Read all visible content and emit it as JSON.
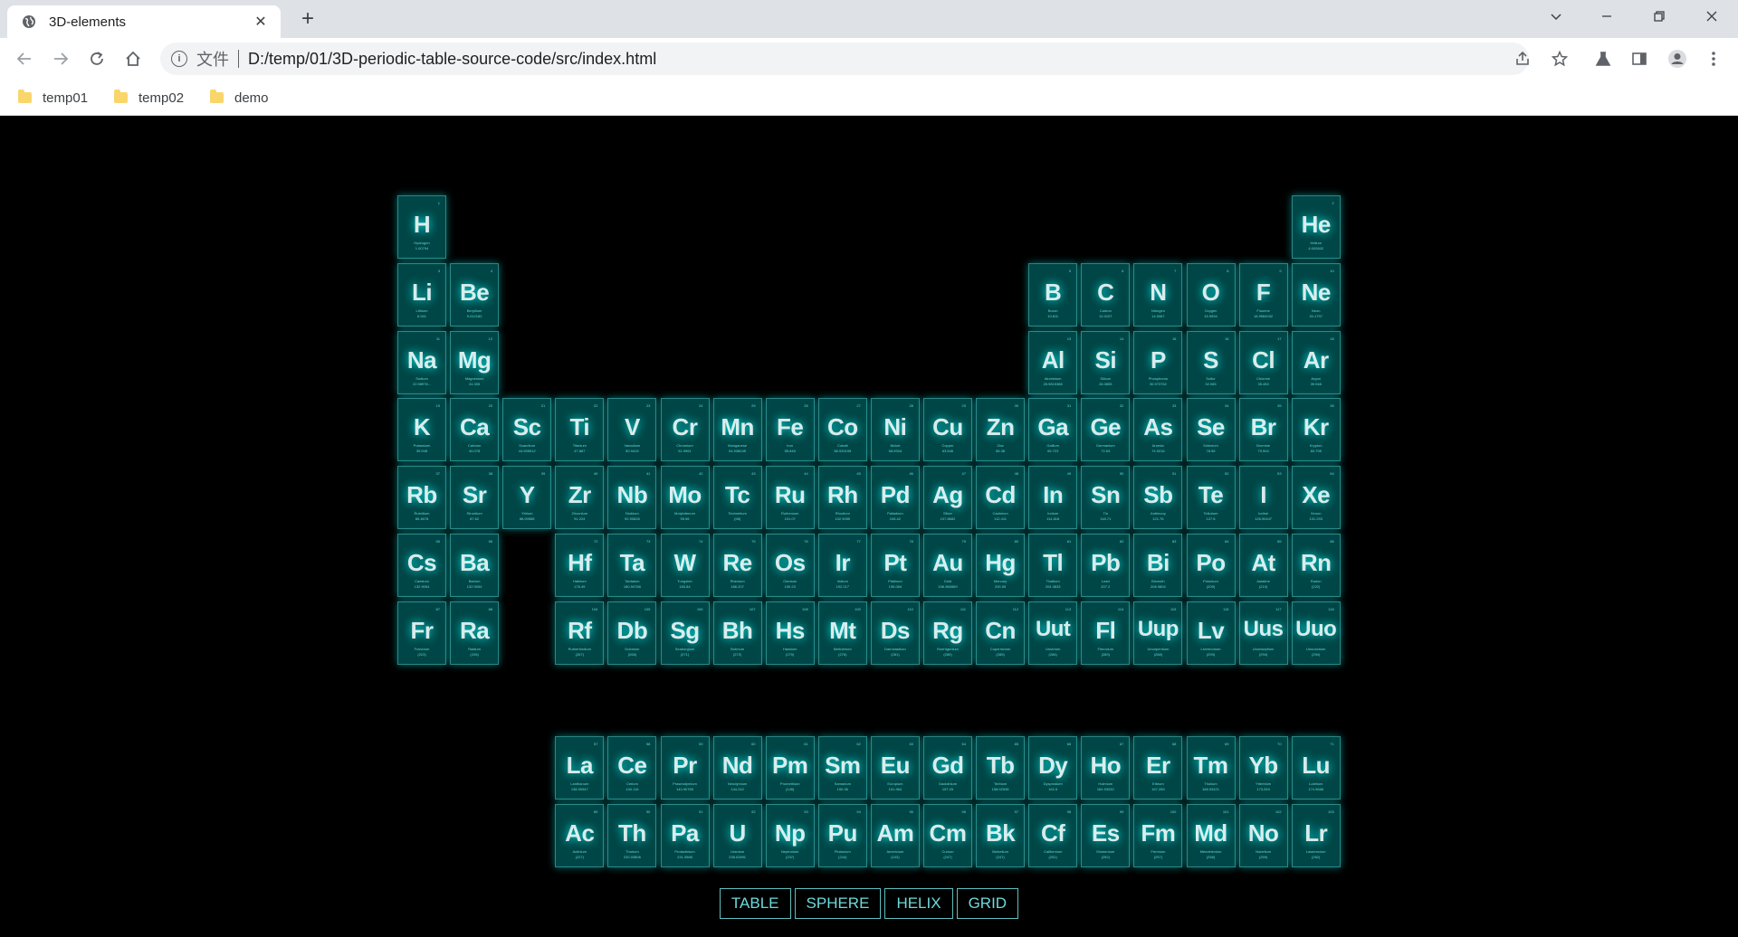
{
  "browser": {
    "tab_title": "3D-elements",
    "scheme_label": "文件",
    "url": "D:/temp/01/3D-periodic-table-source-code/src/index.html",
    "bookmarks": [
      {
        "label": "temp01"
      },
      {
        "label": "temp02"
      },
      {
        "label": "demo"
      }
    ]
  },
  "colors": {
    "background": "#000000",
    "tile": "#007f7f",
    "glow": "#00ffff",
    "bookmark_folder": "#f9d66b"
  },
  "menu": [
    {
      "label": "TABLE"
    },
    {
      "label": "SPHERE"
    },
    {
      "label": "HELIX"
    },
    {
      "label": "GRID"
    }
  ],
  "elements": [
    {
      "num": 1,
      "sym": "H",
      "name": "Hydrogen",
      "weight": "1.00794",
      "col": 1,
      "row": 1
    },
    {
      "num": 2,
      "sym": "He",
      "name": "Helium",
      "weight": "4.002602",
      "col": 18,
      "row": 1
    },
    {
      "num": 3,
      "sym": "Li",
      "name": "Lithium",
      "weight": "6.941",
      "col": 1,
      "row": 2
    },
    {
      "num": 4,
      "sym": "Be",
      "name": "Beryllium",
      "weight": "9.012182",
      "col": 2,
      "row": 2
    },
    {
      "num": 5,
      "sym": "B",
      "name": "Boron",
      "weight": "10.811",
      "col": 13,
      "row": 2
    },
    {
      "num": 6,
      "sym": "C",
      "name": "Carbon",
      "weight": "12.0107",
      "col": 14,
      "row": 2
    },
    {
      "num": 7,
      "sym": "N",
      "name": "Nitrogen",
      "weight": "14.0067",
      "col": 15,
      "row": 2
    },
    {
      "num": 8,
      "sym": "O",
      "name": "Oxygen",
      "weight": "15.9994",
      "col": 16,
      "row": 2
    },
    {
      "num": 9,
      "sym": "F",
      "name": "Fluorine",
      "weight": "18.9984032",
      "col": 17,
      "row": 2
    },
    {
      "num": 10,
      "sym": "Ne",
      "name": "Neon",
      "weight": "20.1797",
      "col": 18,
      "row": 2
    },
    {
      "num": 11,
      "sym": "Na",
      "name": "Sodium",
      "weight": "22.98976...",
      "col": 1,
      "row": 3
    },
    {
      "num": 12,
      "sym": "Mg",
      "name": "Magnesium",
      "weight": "24.305",
      "col": 2,
      "row": 3
    },
    {
      "num": 13,
      "sym": "Al",
      "name": "Aluminium",
      "weight": "26.9815386",
      "col": 13,
      "row": 3
    },
    {
      "num": 14,
      "sym": "Si",
      "name": "Silicon",
      "weight": "28.0855",
      "col": 14,
      "row": 3
    },
    {
      "num": 15,
      "sym": "P",
      "name": "Phosphorus",
      "weight": "30.973762",
      "col": 15,
      "row": 3
    },
    {
      "num": 16,
      "sym": "S",
      "name": "Sulfur",
      "weight": "32.065",
      "col": 16,
      "row": 3
    },
    {
      "num": 17,
      "sym": "Cl",
      "name": "Chlorine",
      "weight": "35.453",
      "col": 17,
      "row": 3
    },
    {
      "num": 18,
      "sym": "Ar",
      "name": "Argon",
      "weight": "39.948",
      "col": 18,
      "row": 3
    },
    {
      "num": 19,
      "sym": "K",
      "name": "Potassium",
      "weight": "39.948",
      "col": 1,
      "row": 4
    },
    {
      "num": 20,
      "sym": "Ca",
      "name": "Calcium",
      "weight": "40.078",
      "col": 2,
      "row": 4
    },
    {
      "num": 21,
      "sym": "Sc",
      "name": "Scandium",
      "weight": "44.955912",
      "col": 3,
      "row": 4
    },
    {
      "num": 22,
      "sym": "Ti",
      "name": "Titanium",
      "weight": "47.867",
      "col": 4,
      "row": 4
    },
    {
      "num": 23,
      "sym": "V",
      "name": "Vanadium",
      "weight": "50.9415",
      "col": 5,
      "row": 4
    },
    {
      "num": 24,
      "sym": "Cr",
      "name": "Chromium",
      "weight": "51.9961",
      "col": 6,
      "row": 4
    },
    {
      "num": 25,
      "sym": "Mn",
      "name": "Manganese",
      "weight": "54.938045",
      "col": 7,
      "row": 4
    },
    {
      "num": 26,
      "sym": "Fe",
      "name": "Iron",
      "weight": "55.845",
      "col": 8,
      "row": 4
    },
    {
      "num": 27,
      "sym": "Co",
      "name": "Cobalt",
      "weight": "58.933195",
      "col": 9,
      "row": 4
    },
    {
      "num": 28,
      "sym": "Ni",
      "name": "Nickel",
      "weight": "58.6934",
      "col": 10,
      "row": 4
    },
    {
      "num": 29,
      "sym": "Cu",
      "name": "Copper",
      "weight": "63.546",
      "col": 11,
      "row": 4
    },
    {
      "num": 30,
      "sym": "Zn",
      "name": "Zinc",
      "weight": "65.38",
      "col": 12,
      "row": 4
    },
    {
      "num": 31,
      "sym": "Ga",
      "name": "Gallium",
      "weight": "69.723",
      "col": 13,
      "row": 4
    },
    {
      "num": 32,
      "sym": "Ge",
      "name": "Germanium",
      "weight": "72.63",
      "col": 14,
      "row": 4
    },
    {
      "num": 33,
      "sym": "As",
      "name": "Arsenic",
      "weight": "74.9216",
      "col": 15,
      "row": 4
    },
    {
      "num": 34,
      "sym": "Se",
      "name": "Selenium",
      "weight": "78.96",
      "col": 16,
      "row": 4
    },
    {
      "num": 35,
      "sym": "Br",
      "name": "Bromine",
      "weight": "79.904",
      "col": 17,
      "row": 4
    },
    {
      "num": 36,
      "sym": "Kr",
      "name": "Krypton",
      "weight": "83.798",
      "col": 18,
      "row": 4
    },
    {
      "num": 37,
      "sym": "Rb",
      "name": "Rubidium",
      "weight": "85.4678",
      "col": 1,
      "row": 5
    },
    {
      "num": 38,
      "sym": "Sr",
      "name": "Strontium",
      "weight": "87.62",
      "col": 2,
      "row": 5
    },
    {
      "num": 39,
      "sym": "Y",
      "name": "Yttrium",
      "weight": "88.90585",
      "col": 3,
      "row": 5
    },
    {
      "num": 40,
      "sym": "Zr",
      "name": "Zirconium",
      "weight": "91.224",
      "col": 4,
      "row": 5
    },
    {
      "num": 41,
      "sym": "Nb",
      "name": "Niobium",
      "weight": "92.90628",
      "col": 5,
      "row": 5
    },
    {
      "num": 42,
      "sym": "Mo",
      "name": "Molybdenum",
      "weight": "95.96",
      "col": 6,
      "row": 5
    },
    {
      "num": 43,
      "sym": "Tc",
      "name": "Technetium",
      "weight": "(98)",
      "col": 7,
      "row": 5
    },
    {
      "num": 44,
      "sym": "Ru",
      "name": "Ruthenium",
      "weight": "101.07",
      "col": 8,
      "row": 5
    },
    {
      "num": 45,
      "sym": "Rh",
      "name": "Rhodium",
      "weight": "102.9055",
      "col": 9,
      "row": 5
    },
    {
      "num": 46,
      "sym": "Pd",
      "name": "Palladium",
      "weight": "106.42",
      "col": 10,
      "row": 5
    },
    {
      "num": 47,
      "sym": "Ag",
      "name": "Silver",
      "weight": "107.8682",
      "col": 11,
      "row": 5
    },
    {
      "num": 48,
      "sym": "Cd",
      "name": "Cadmium",
      "weight": "112.411",
      "col": 12,
      "row": 5
    },
    {
      "num": 49,
      "sym": "In",
      "name": "Indium",
      "weight": "114.818",
      "col": 13,
      "row": 5
    },
    {
      "num": 50,
      "sym": "Sn",
      "name": "Tin",
      "weight": "118.71",
      "col": 14,
      "row": 5
    },
    {
      "num": 51,
      "sym": "Sb",
      "name": "Antimony",
      "weight": "121.76",
      "col": 15,
      "row": 5
    },
    {
      "num": 52,
      "sym": "Te",
      "name": "Tellurium",
      "weight": "127.6",
      "col": 16,
      "row": 5
    },
    {
      "num": 53,
      "sym": "I",
      "name": "Iodine",
      "weight": "126.90447",
      "col": 17,
      "row": 5
    },
    {
      "num": 54,
      "sym": "Xe",
      "name": "Xenon",
      "weight": "131.293",
      "col": 18,
      "row": 5
    },
    {
      "num": 55,
      "sym": "Cs",
      "name": "Caesium",
      "weight": "132.9054",
      "col": 1,
      "row": 6
    },
    {
      "num": 56,
      "sym": "Ba",
      "name": "Barium",
      "weight": "132.9054",
      "col": 2,
      "row": 6
    },
    {
      "num": 72,
      "sym": "Hf",
      "name": "Hafnium",
      "weight": "178.49",
      "col": 4,
      "row": 6
    },
    {
      "num": 73,
      "sym": "Ta",
      "name": "Tantalum",
      "weight": "180.94788",
      "col": 5,
      "row": 6
    },
    {
      "num": 74,
      "sym": "W",
      "name": "Tungsten",
      "weight": "183.84",
      "col": 6,
      "row": 6
    },
    {
      "num": 75,
      "sym": "Re",
      "name": "Rhenium",
      "weight": "186.207",
      "col": 7,
      "row": 6
    },
    {
      "num": 76,
      "sym": "Os",
      "name": "Osmium",
      "weight": "190.23",
      "col": 8,
      "row": 6
    },
    {
      "num": 77,
      "sym": "Ir",
      "name": "Iridium",
      "weight": "192.217",
      "col": 9,
      "row": 6
    },
    {
      "num": 78,
      "sym": "Pt",
      "name": "Platinum",
      "weight": "195.084",
      "col": 10,
      "row": 6
    },
    {
      "num": 79,
      "sym": "Au",
      "name": "Gold",
      "weight": "196.966569",
      "col": 11,
      "row": 6
    },
    {
      "num": 80,
      "sym": "Hg",
      "name": "Mercury",
      "weight": "200.59",
      "col": 12,
      "row": 6
    },
    {
      "num": 81,
      "sym": "Tl",
      "name": "Thallium",
      "weight": "204.3833",
      "col": 13,
      "row": 6
    },
    {
      "num": 82,
      "sym": "Pb",
      "name": "Lead",
      "weight": "207.2",
      "col": 14,
      "row": 6
    },
    {
      "num": 83,
      "sym": "Bi",
      "name": "Bismuth",
      "weight": "208.9804",
      "col": 15,
      "row": 6
    },
    {
      "num": 84,
      "sym": "Po",
      "name": "Polonium",
      "weight": "(209)",
      "col": 16,
      "row": 6
    },
    {
      "num": 85,
      "sym": "At",
      "name": "Astatine",
      "weight": "(210)",
      "col": 17,
      "row": 6
    },
    {
      "num": 86,
      "sym": "Rn",
      "name": "Radon",
      "weight": "(222)",
      "col": 18,
      "row": 6
    },
    {
      "num": 87,
      "sym": "Fr",
      "name": "Francium",
      "weight": "(223)",
      "col": 1,
      "row": 7
    },
    {
      "num": 88,
      "sym": "Ra",
      "name": "Radium",
      "weight": "(226)",
      "col": 2,
      "row": 7
    },
    {
      "num": 104,
      "sym": "Rf",
      "name": "Rutherfordium",
      "weight": "(267)",
      "col": 4,
      "row": 7
    },
    {
      "num": 105,
      "sym": "Db",
      "name": "Dubnium",
      "weight": "(268)",
      "col": 5,
      "row": 7
    },
    {
      "num": 106,
      "sym": "Sg",
      "name": "Seaborgium",
      "weight": "(271)",
      "col": 6,
      "row": 7
    },
    {
      "num": 107,
      "sym": "Bh",
      "name": "Bohrium",
      "weight": "(272)",
      "col": 7,
      "row": 7
    },
    {
      "num": 108,
      "sym": "Hs",
      "name": "Hassium",
      "weight": "(270)",
      "col": 8,
      "row": 7
    },
    {
      "num": 109,
      "sym": "Mt",
      "name": "Meitnerium",
      "weight": "(276)",
      "col": 9,
      "row": 7
    },
    {
      "num": 110,
      "sym": "Ds",
      "name": "Darmstadium",
      "weight": "(281)",
      "col": 10,
      "row": 7
    },
    {
      "num": 111,
      "sym": "Rg",
      "name": "Roentgenium",
      "weight": "(280)",
      "col": 11,
      "row": 7
    },
    {
      "num": 112,
      "sym": "Cn",
      "name": "Copernicium",
      "weight": "(285)",
      "col": 12,
      "row": 7
    },
    {
      "num": 113,
      "sym": "Uut",
      "name": "Unutrium",
      "weight": "(284)",
      "col": 13,
      "row": 7
    },
    {
      "num": 114,
      "sym": "Fl",
      "name": "Flerovium",
      "weight": "(289)",
      "col": 14,
      "row": 7
    },
    {
      "num": 115,
      "sym": "Uup",
      "name": "Ununpentium",
      "weight": "(288)",
      "col": 15,
      "row": 7
    },
    {
      "num": 116,
      "sym": "Lv",
      "name": "Livermorium",
      "weight": "(293)",
      "col": 16,
      "row": 7
    },
    {
      "num": 117,
      "sym": "Uus",
      "name": "Ununseptium",
      "weight": "(294)",
      "col": 17,
      "row": 7
    },
    {
      "num": 118,
      "sym": "Uuo",
      "name": "Ununoctium",
      "weight": "(294)",
      "col": 18,
      "row": 7
    },
    {
      "num": 57,
      "sym": "La",
      "name": "Lanthanum",
      "weight": "138.90547",
      "col": 4,
      "row": 9
    },
    {
      "num": 58,
      "sym": "Ce",
      "name": "Cerium",
      "weight": "140.116",
      "col": 5,
      "row": 9
    },
    {
      "num": 59,
      "sym": "Pr",
      "name": "Praseodymium",
      "weight": "140.90765",
      "col": 6,
      "row": 9
    },
    {
      "num": 60,
      "sym": "Nd",
      "name": "Neodymium",
      "weight": "144.242",
      "col": 7,
      "row": 9
    },
    {
      "num": 61,
      "sym": "Pm",
      "name": "Promethium",
      "weight": "(145)",
      "col": 8,
      "row": 9
    },
    {
      "num": 62,
      "sym": "Sm",
      "name": "Samarium",
      "weight": "150.36",
      "col": 9,
      "row": 9
    },
    {
      "num": 63,
      "sym": "Eu",
      "name": "Europium",
      "weight": "151.964",
      "col": 10,
      "row": 9
    },
    {
      "num": 64,
      "sym": "Gd",
      "name": "Gadolinium",
      "weight": "157.25",
      "col": 11,
      "row": 9
    },
    {
      "num": 65,
      "sym": "Tb",
      "name": "Terbium",
      "weight": "158.92535",
      "col": 12,
      "row": 9
    },
    {
      "num": 66,
      "sym": "Dy",
      "name": "Dysprosium",
      "weight": "162.5",
      "col": 13,
      "row": 9
    },
    {
      "num": 67,
      "sym": "Ho",
      "name": "Holmium",
      "weight": "164.93032",
      "col": 14,
      "row": 9
    },
    {
      "num": 68,
      "sym": "Er",
      "name": "Erbium",
      "weight": "167.259",
      "col": 15,
      "row": 9
    },
    {
      "num": 69,
      "sym": "Tm",
      "name": "Thulium",
      "weight": "168.93421",
      "col": 16,
      "row": 9
    },
    {
      "num": 70,
      "sym": "Yb",
      "name": "Ytterbium",
      "weight": "173.054",
      "col": 17,
      "row": 9
    },
    {
      "num": 71,
      "sym": "Lu",
      "name": "Lutetium",
      "weight": "174.9668",
      "col": 18,
      "row": 9
    },
    {
      "num": 89,
      "sym": "Ac",
      "name": "Actinium",
      "weight": "(227)",
      "col": 4,
      "row": 10
    },
    {
      "num": 90,
      "sym": "Th",
      "name": "Thorium",
      "weight": "232.03806",
      "col": 5,
      "row": 10
    },
    {
      "num": 91,
      "sym": "Pa",
      "name": "Protactinium",
      "weight": "231.0588",
      "col": 6,
      "row": 10
    },
    {
      "num": 92,
      "sym": "U",
      "name": "Uranium",
      "weight": "238.02891",
      "col": 7,
      "row": 10
    },
    {
      "num": 93,
      "sym": "Np",
      "name": "Neptunium",
      "weight": "(237)",
      "col": 8,
      "row": 10
    },
    {
      "num": 94,
      "sym": "Pu",
      "name": "Plutonium",
      "weight": "(244)",
      "col": 9,
      "row": 10
    },
    {
      "num": 95,
      "sym": "Am",
      "name": "Americium",
      "weight": "(243)",
      "col": 10,
      "row": 10
    },
    {
      "num": 96,
      "sym": "Cm",
      "name": "Curium",
      "weight": "(247)",
      "col": 11,
      "row": 10
    },
    {
      "num": 97,
      "sym": "Bk",
      "name": "Berkelium",
      "weight": "(247)",
      "col": 12,
      "row": 10
    },
    {
      "num": 98,
      "sym": "Cf",
      "name": "Californium",
      "weight": "(251)",
      "col": 13,
      "row": 10
    },
    {
      "num": 99,
      "sym": "Es",
      "name": "Einstenium",
      "weight": "(252)",
      "col": 14,
      "row": 10
    },
    {
      "num": 100,
      "sym": "Fm",
      "name": "Fermium",
      "weight": "(257)",
      "col": 15,
      "row": 10
    },
    {
      "num": 101,
      "sym": "Md",
      "name": "Mendelevium",
      "weight": "(258)",
      "col": 16,
      "row": 10
    },
    {
      "num": 102,
      "sym": "No",
      "name": "Nobelium",
      "weight": "(259)",
      "col": 17,
      "row": 10
    },
    {
      "num": 103,
      "sym": "Lr",
      "name": "Lawrencium",
      "weight": "(262)",
      "col": 18,
      "row": 10
    }
  ]
}
